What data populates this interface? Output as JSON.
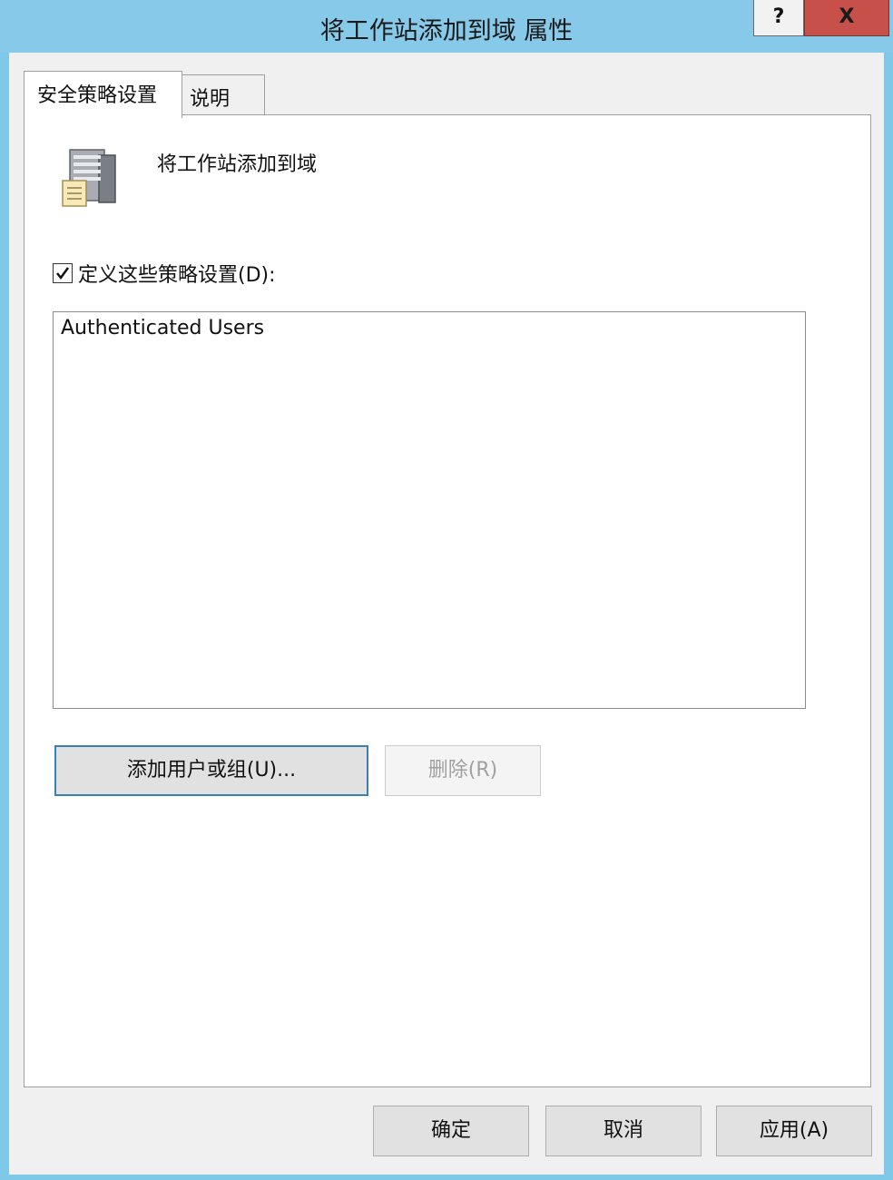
{
  "window": {
    "title": "将工作站添加到域 属性",
    "help_label": "?",
    "close_label": "X"
  },
  "tabs": [
    {
      "label": "安全策略设置",
      "active": true
    },
    {
      "label": "说明",
      "active": false
    }
  ],
  "policy": {
    "name": "将工作站添加到域",
    "icon": "server-icon",
    "define_checkbox": {
      "label": "定义这些策略设置(D):",
      "checked": true
    }
  },
  "members": [
    "Authenticated Users"
  ],
  "buttons": {
    "add": "添加用户或组(U)...",
    "remove": "删除(R)",
    "ok": "确定",
    "cancel": "取消",
    "apply": "应用(A)"
  },
  "colors": {
    "titlebar": "#86c9e9",
    "close_button": "#c7504a",
    "focus_border": "#3c7fb1"
  }
}
